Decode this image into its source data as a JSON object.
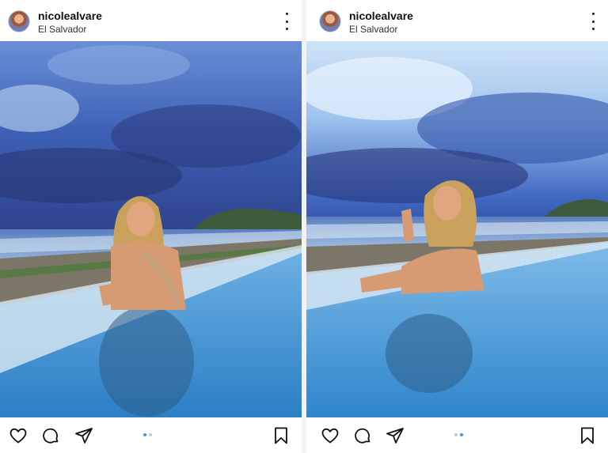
{
  "colors": {
    "text": "#111111",
    "secondary": "#333333",
    "indicator_active": "#3897f0",
    "indicator_inactive": "#c7c7c7"
  },
  "posts": [
    {
      "username": "nicolealvare",
      "location": "El Salvador",
      "actions": [
        "heart-icon",
        "comment-icon",
        "share-icon",
        "bookmark-icon"
      ],
      "carousel": {
        "count": 2,
        "active": 1
      }
    },
    {
      "username": "nicolealvare",
      "location": "El Salvador",
      "actions": [
        "heart-icon",
        "comment-icon",
        "share-icon",
        "bookmark-icon"
      ],
      "carousel": {
        "count": 2,
        "active": 2
      }
    }
  ]
}
